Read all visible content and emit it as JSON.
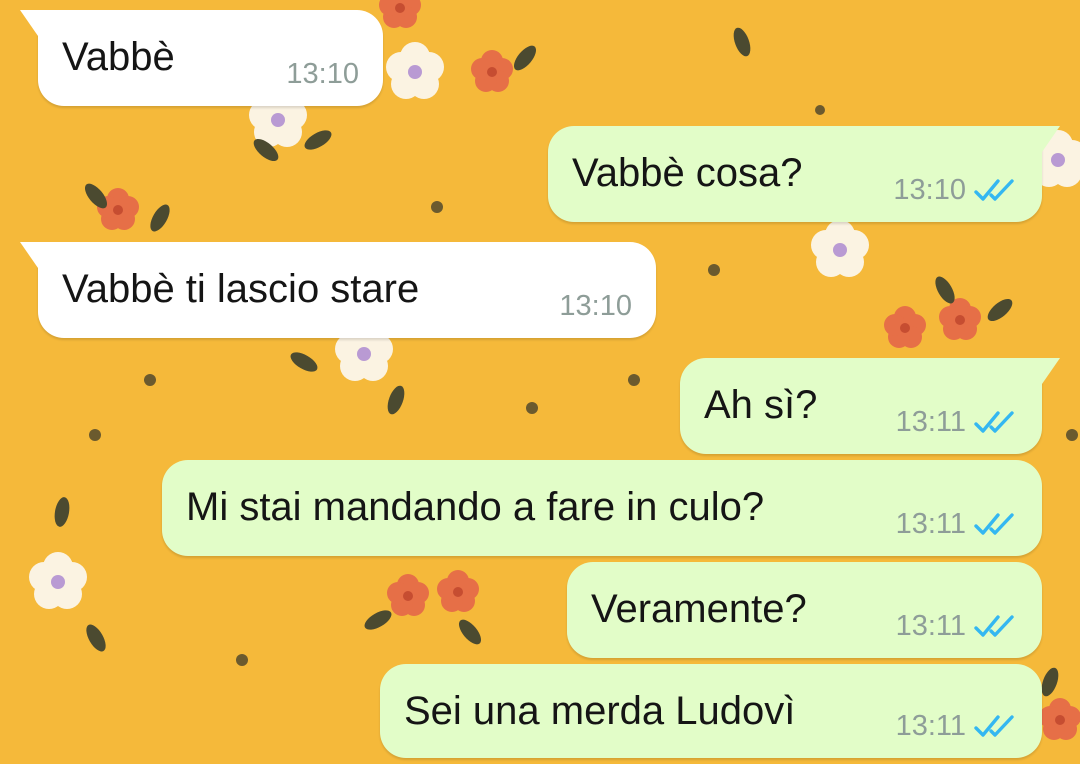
{
  "colors": {
    "wallpaper": "#f5b93a",
    "incoming_bubble": "#ffffff",
    "outgoing_bubble": "#e2fdc8",
    "read_ticks": "#34b7f1",
    "timestamp": "#8e9d98"
  },
  "messages": [
    {
      "direction": "incoming",
      "text": "Vabbè",
      "time": "13:10"
    },
    {
      "direction": "outgoing",
      "text": "Vabbè cosa?",
      "time": "13:10",
      "status": "read",
      "status_icon": "double-check-icon"
    },
    {
      "direction": "incoming",
      "text": "Vabbè ti lascio stare",
      "time": "13:10"
    },
    {
      "direction": "outgoing",
      "text": "Ah sì?",
      "time": "13:11",
      "status": "read",
      "status_icon": "double-check-icon"
    },
    {
      "direction": "outgoing",
      "text": "Mi stai mandando a fare in culo?",
      "time": "13:11",
      "status": "read",
      "status_icon": "double-check-icon"
    },
    {
      "direction": "outgoing",
      "text": "Veramente?",
      "time": "13:11",
      "status": "read",
      "status_icon": "double-check-icon"
    },
    {
      "direction": "outgoing",
      "text": "Sei una merda Ludovì",
      "time": "13:11",
      "status": "read",
      "status_icon": "double-check-icon"
    }
  ]
}
